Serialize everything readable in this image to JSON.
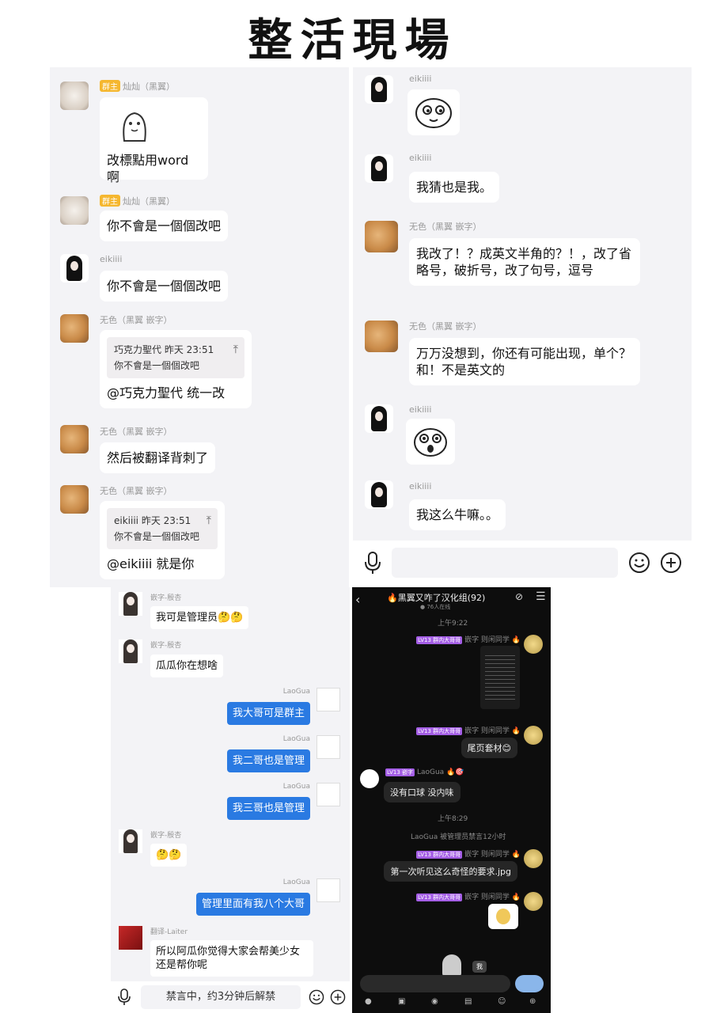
{
  "title": "整活現場",
  "p1": {
    "m1": {
      "badge": "群主",
      "name": "灿灿（黑翼）",
      "text": "改標點用word 啊"
    },
    "m2": {
      "badge": "群主",
      "name": "灿灿（黑翼）",
      "text": "你不會是一個個改吧"
    },
    "m3": {
      "name": "eikiiii",
      "text": "你不會是一個個改吧"
    },
    "m4": {
      "name": "无色（黑翼 嵌字）",
      "quote_head": "巧克力聖代 昨天 23:51",
      "quote_text": "你不會是一個個改吧",
      "text": "@巧克力聖代 统一改"
    },
    "m5": {
      "name": "无色（黑翼 嵌字）",
      "text": "然后被翻译背刺了"
    },
    "m6": {
      "name": "无色（黑翼 嵌字）",
      "quote_head": "eikiiii 昨天 23:51",
      "quote_text": "你不會是一個個改吧",
      "text": "@eikiiii 就是你"
    }
  },
  "p2": {
    "m1": {
      "name": "eikiiii"
    },
    "m2": {
      "name": "eikiiii",
      "text": "我猜也是我。"
    },
    "m3": {
      "name": "无色（黑翼 嵌字）",
      "text": "我改了！？成英文半角的？！，改了省略号，破折号，改了句号，逗号"
    },
    "m4": {
      "name": "无色（黑翼 嵌字）",
      "text": "万万没想到，你还有可能出现，单个？和！不是英文的"
    },
    "m5": {
      "name": "eikiiii"
    },
    "m6": {
      "name": "eikiiii",
      "text": "我这么牛嘛。。"
    }
  },
  "p3": {
    "m1": {
      "name": "嵌字-殷杏",
      "text": "我可是管理员🤔🤔"
    },
    "m2": {
      "name": "嵌字-殷杏",
      "text": "瓜瓜你在想啥"
    },
    "m3": {
      "name": "LaoGua",
      "text": "我大哥可是群主"
    },
    "m4": {
      "name": "LaoGua",
      "text": "我二哥也是管理"
    },
    "m5": {
      "name": "LaoGua",
      "text": "我三哥也是管理"
    },
    "m6": {
      "name": "嵌字-殷杏",
      "text": "🤔🤔"
    },
    "m7": {
      "name": "LaoGua",
      "text": "管理里面有我八个大哥"
    },
    "m8": {
      "name": "翻译-Laiter",
      "text": "所以阿瓜你觉得大家会帮美少女还是帮你呢"
    },
    "input": "禁言中，约3分钟后解禁"
  },
  "p4": {
    "group": "🔥黑翼又咋了汉化组(92)",
    "online": "● 76人在线",
    "time1": "上午9:22",
    "time2": "上午8:29",
    "tag": "LV13 群内大哥哥",
    "sender": "嵌字 则闲同学 🔥",
    "m2": "尾页套材😊",
    "laogua_name": "LaoGua 🔥🎯",
    "laogua_tag": "LV13 嵌字",
    "m3": "没有口球 没内味",
    "mute": "LaoGua 被管理员禁言12小时",
    "m4": "第一次听见这么奇怪的要求.jpg",
    "sticker_label": "我"
  }
}
